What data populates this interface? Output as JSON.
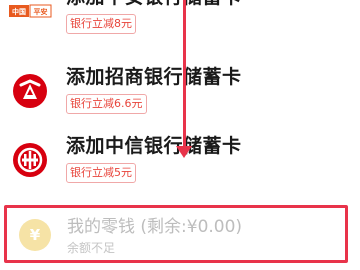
{
  "banks": [
    {
      "name": "添加平安银行储蓄卡",
      "promo": "银行立减8元",
      "icon": "pingan-bank-logo-icon",
      "logo_text": "中国平安",
      "color": "#e85a1f"
    },
    {
      "name": "添加招商银行储蓄卡",
      "promo": "银行立减6.6元",
      "icon": "cmb-bank-logo-icon",
      "color": "#d7000f"
    },
    {
      "name": "添加中信银行储蓄卡",
      "promo": "银行立减5元",
      "icon": "citic-bank-logo-icon",
      "color": "#d7000f"
    }
  ],
  "wallet": {
    "title": "我的零钱 (剩余:¥0.00)",
    "subtitle": "余额不足",
    "icon_symbol": "¥",
    "icon": "yuan-wallet-icon",
    "icon_color": "#f6e3a6",
    "highlight_color": "#e8334a"
  },
  "annotation": {
    "arrow_color": "#e8334a"
  }
}
